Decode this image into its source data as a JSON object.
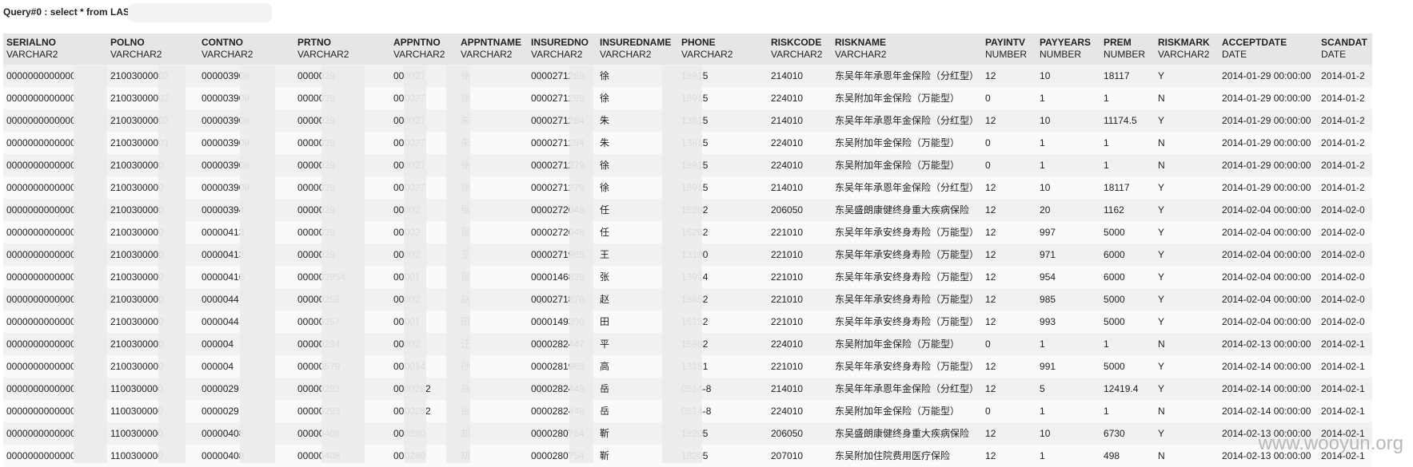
{
  "query_text": "Query#0 : select * from LAS",
  "columns": [
    {
      "name": "SERIALNO",
      "type": "VARCHAR2"
    },
    {
      "name": "POLNO",
      "type": "VARCHAR2"
    },
    {
      "name": "CONTNO",
      "type": "VARCHAR2"
    },
    {
      "name": "PRTNO",
      "type": "VARCHAR2"
    },
    {
      "name": "APPNTNO",
      "type": "VARCHAR2"
    },
    {
      "name": "APPNTNAME",
      "type": "VARCHAR2"
    },
    {
      "name": "INSUREDNO",
      "type": "VARCHAR2"
    },
    {
      "name": "INSUREDNAME",
      "type": "VARCHAR2"
    },
    {
      "name": "PHONE",
      "type": "VARCHAR2"
    },
    {
      "name": "RISKCODE",
      "type": "VARCHAR2"
    },
    {
      "name": "RISKNAME",
      "type": "VARCHAR2"
    },
    {
      "name": "PAYINTV",
      "type": "NUMBER"
    },
    {
      "name": "PAYYEARS",
      "type": "NUMBER"
    },
    {
      "name": "PREM",
      "type": "NUMBER"
    },
    {
      "name": "RISKMARK",
      "type": "VARCHAR2"
    },
    {
      "name": "ACCEPTDATE",
      "type": "DATE"
    },
    {
      "name": "SCANDAT",
      "type": "DATE"
    }
  ],
  "rows": [
    [
      "0000000000000",
      "21003000002",
      "000003908",
      "0000039",
      "000027",
      "徐",
      "0000271269",
      "徐",
      "18915",
      "214010",
      "东吴年年承恩年金保险（分红型）",
      "12",
      "10",
      "18117",
      "Y",
      "2014-01-29 00:00:00",
      "2014-01-2"
    ],
    [
      "0000000000000",
      "21003000002",
      "000003908",
      "0000039",
      "000027",
      "徐",
      "0000271269",
      "徐",
      "18915",
      "224010",
      "东吴附加年金保险（万能型）",
      "0",
      "1",
      "1",
      "N",
      "2014-01-29 00:00:00",
      "2014-01-2"
    ],
    [
      "0000000000000",
      "21003000002",
      "000003908",
      "0000039",
      "000027",
      "朱",
      "0000271284",
      "朱",
      "13815",
      "214010",
      "东吴年年承恩年金保险（分红型）",
      "12",
      "10",
      "11174.5",
      "Y",
      "2014-01-29 00:00:00",
      "2014-01-2"
    ],
    [
      "0000000000000",
      "21003000001",
      "000003908",
      "0000039",
      "000027",
      "朱",
      "0000271284",
      "朱",
      "13815",
      "224010",
      "东吴附加年金保险（万能型）",
      "0",
      "1",
      "1",
      "N",
      "2014-01-29 00:00:00",
      "2014-01-2"
    ],
    [
      "0000000000000",
      "2100300000",
      "000003908",
      "0000039",
      "000027",
      "徐",
      "0000271279",
      "徐",
      "18915",
      "224010",
      "东吴附加年金保险（万能型）",
      "0",
      "1",
      "1",
      "N",
      "2014-01-29 00:00:00",
      "2014-01-2"
    ],
    [
      "0000000000000",
      "2100300000",
      "000003908",
      "0000039",
      "000027",
      "徐",
      "0000271279",
      "徐",
      "18915",
      "214010",
      "东吴年年承恩年金保险（分红型）",
      "12",
      "10",
      "18117",
      "Y",
      "2014-01-29 00:00:00",
      "2014-01-2"
    ],
    [
      "0000000000000",
      "2100300000",
      "00000394",
      "0000039",
      "00002",
      "张",
      "0000272048",
      "任",
      "15262",
      "206050",
      "东吴盛朗康健终身重大疾病保险",
      "12",
      "20",
      "1162",
      "Y",
      "2014-02-04 00:00:00",
      "2014-02-0"
    ],
    [
      "0000000000000",
      "2100300000",
      "00000413",
      "0000039",
      "00002",
      "张",
      "0000272048",
      "任",
      "15262",
      "221010",
      "东吴年年承安终身寿险（万能型）",
      "12",
      "997",
      "5000",
      "Y",
      "2014-02-04 00:00:00",
      "2014-02-0"
    ],
    [
      "0000000000000",
      "2100300000",
      "00000413",
      "0000039",
      "00002",
      "王",
      "0000271965",
      "王",
      "13190",
      "221010",
      "东吴年年承安终身寿险（万能型）",
      "12",
      "971",
      "6000",
      "Y",
      "2014-02-04 00:00:00",
      "2014-02-0"
    ],
    [
      "0000000000000",
      "2100300000",
      "00000416",
      "000003954",
      "00001",
      "张",
      "0000146839",
      "张",
      "13914",
      "221010",
      "东吴年年承安终身寿险（万能型）",
      "12",
      "954",
      "6000",
      "Y",
      "2014-02-04 00:00:00",
      "2014-02-0"
    ],
    [
      "0000000000000",
      "2100300000",
      "0000044",
      "00000258",
      "00002",
      "赵",
      "0000271870",
      "赵",
      "18652",
      "221010",
      "东吴年年承安终身寿险（万能型）",
      "12",
      "985",
      "5000",
      "Y",
      "2014-02-04 00:00:00",
      "2014-02-0"
    ],
    [
      "0000000000000",
      "2100300000",
      "0000044",
      "00000257",
      "00001",
      "田",
      "0000149300",
      "田",
      "15152",
      "221010",
      "东吴年年承安终身寿险（万能型）",
      "12",
      "993",
      "5000",
      "Y",
      "2014-02-04 00:00:00",
      "2014-02-0"
    ],
    [
      "0000000000000",
      "2100300000",
      "000004",
      "00000234",
      "00002",
      "汪",
      "0000282447",
      "平",
      "15962",
      "224010",
      "东吴附加年金保险（万能型）",
      "0",
      "1",
      "1",
      "N",
      "2014-02-13 00:00:00",
      "2014-02-1"
    ],
    [
      "0000000000000",
      "2100300000",
      "000004",
      "00000579",
      "000014",
      "孙",
      "0000281963",
      "高",
      "13151",
      "221010",
      "东吴年年承安终身寿险（万能型）",
      "12",
      "991",
      "5000",
      "Y",
      "2014-02-14 00:00:00",
      "2014-02-1"
    ],
    [
      "0000000000000",
      "1100300000",
      "0000029",
      "00000293",
      "0000282",
      "岳",
      "0000282449",
      "岳",
      "0514-8",
      "214010",
      "东吴年年承恩年金保险（分红型）",
      "12",
      "5",
      "12419.4",
      "Y",
      "2014-02-14 00:00:00",
      "2014-02-1"
    ],
    [
      "0000000000000",
      "1100300000",
      "0000029",
      "00000293",
      "0000282",
      "岳",
      "0000282449",
      "岳",
      "0514-8",
      "224010",
      "东吴附加年金保险（万能型）",
      "0",
      "1",
      "1",
      "N",
      "2014-02-14 00:00:00",
      "2014-02-1"
    ],
    [
      "0000000000000",
      "1100300000",
      "00000408",
      "00000408",
      "000280",
      "胡",
      "0000280754",
      "靳",
      "18205",
      "206050",
      "东吴盛朗康健终身重大疾病保险",
      "12",
      "10",
      "6730",
      "Y",
      "2014-02-13 00:00:00",
      "2014-02-1"
    ],
    [
      "0000000000000",
      "1100300000",
      "00000408",
      "00000408",
      "000280",
      "胡",
      "0000280754",
      "靳",
      "18205",
      "207010",
      "东吴附加住院费用医疗保险",
      "12",
      "1",
      "498",
      "N",
      "2014-02-13 00:00:00",
      "2014-02-1"
    ]
  ],
  "watermark": "www.wooyun.org"
}
